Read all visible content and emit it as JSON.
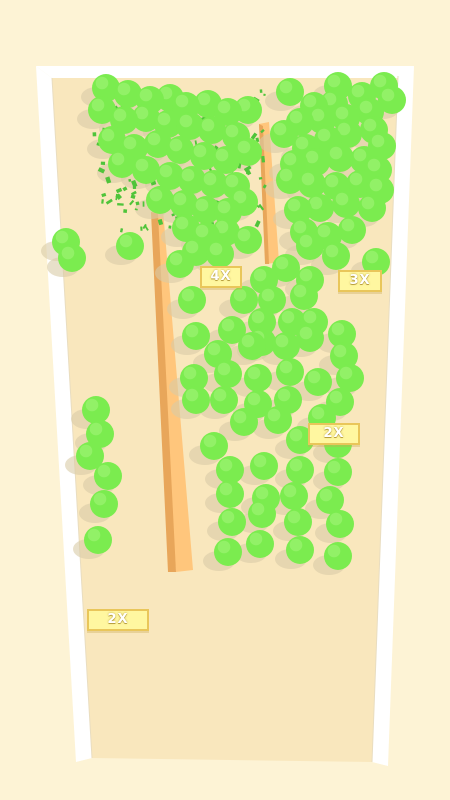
{
  "game": {
    "colors": {
      "background": "#fdf3d5",
      "floor": "#f9e7bd",
      "wall": "#ffffff",
      "wall_shadow": "#e9ddc0",
      "divider": "#ffc67c",
      "divider_side": "#e8a65a",
      "tree": "#7bec4f",
      "tree_highlight": "#a6f57b",
      "tree_shadow": "#d9cca6",
      "leaf_particles": "#4fc43a",
      "badge_fill": "#fff7a0",
      "badge_border": "#e9c65a"
    },
    "multipliers": [
      {
        "label": "4X"
      },
      {
        "label": "3X"
      },
      {
        "label": "2X"
      },
      {
        "label": "2X"
      }
    ]
  }
}
